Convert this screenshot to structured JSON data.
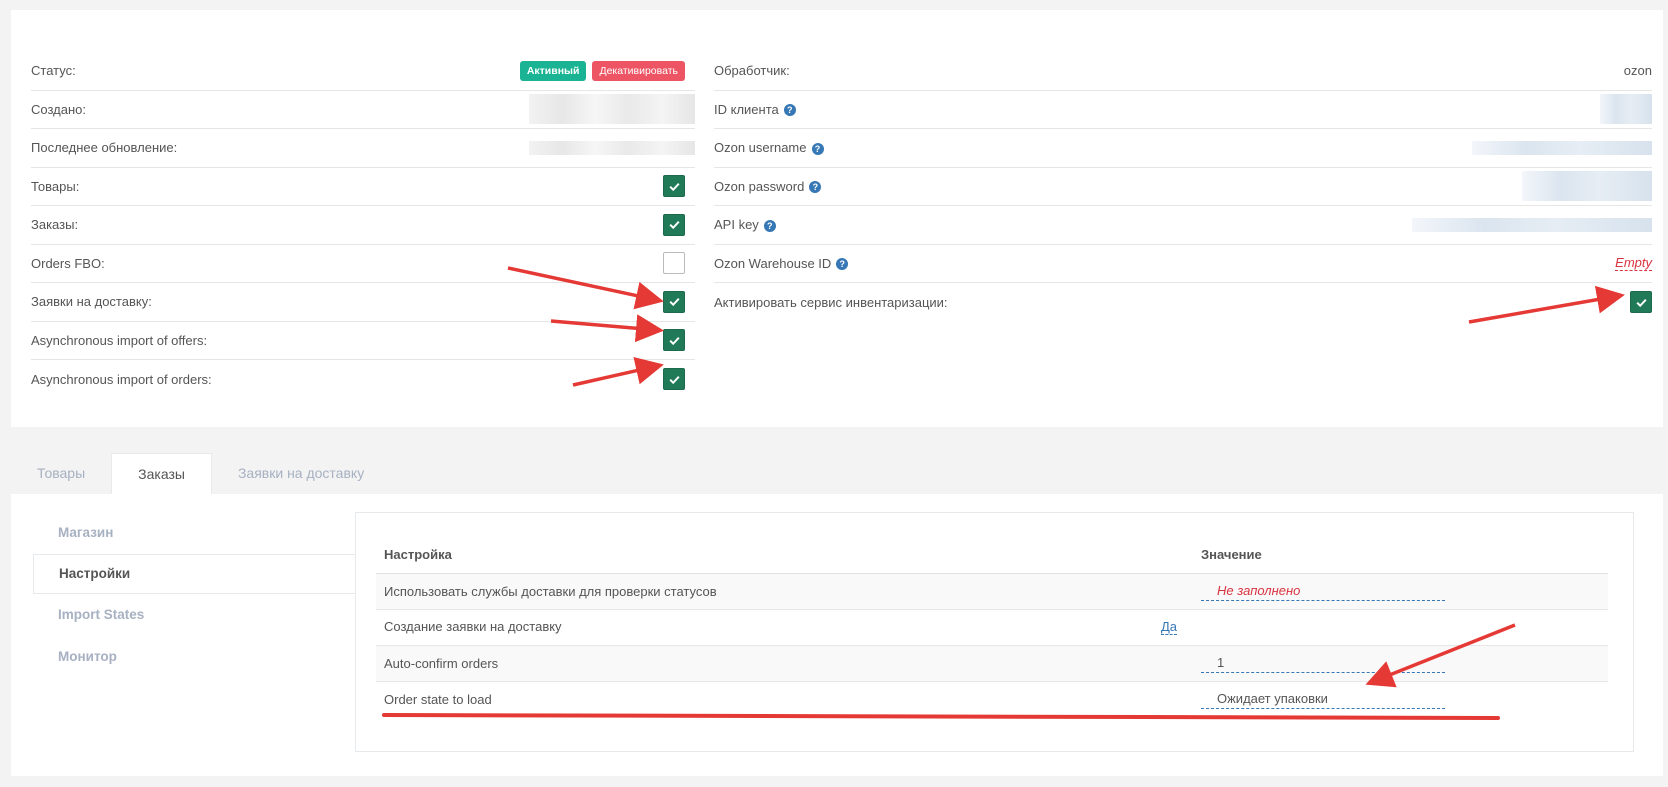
{
  "status_panel": {
    "left": [
      {
        "label": "Статус:",
        "type": "status"
      },
      {
        "label": "Создано:",
        "type": "blurred"
      },
      {
        "label": "Последнее обновление:",
        "type": "blurred-short"
      },
      {
        "label": "Товары:",
        "type": "checkbox",
        "checked": true
      },
      {
        "label": "Заказы:",
        "type": "checkbox",
        "checked": true
      },
      {
        "label": "Orders FBO:",
        "type": "checkbox",
        "checked": false
      },
      {
        "label": "Заявки на доставку:",
        "type": "checkbox",
        "checked": true
      },
      {
        "label": "Asynchronous import of offers:",
        "type": "checkbox",
        "checked": true
      },
      {
        "label": "Asynchronous import of orders:",
        "type": "checkbox",
        "checked": true
      }
    ],
    "status_badge": "Активный",
    "deactivate_button": "Декативировать",
    "right": [
      {
        "label": "Обработчик:",
        "value": "ozon"
      },
      {
        "label": "ID клиента",
        "help": true
      },
      {
        "label": "Ozon username",
        "help": true
      },
      {
        "label": "Ozon password",
        "help": true
      },
      {
        "label": "API key",
        "help": true
      },
      {
        "label": "Ozon Warehouse ID",
        "help": true,
        "value": "Empty"
      },
      {
        "label": "Активировать сервис инвентаризации:",
        "checkbox": true,
        "checked": true
      }
    ]
  },
  "tabs": [
    "Товары",
    "Заказы",
    "Заявки на доставку"
  ],
  "active_tab": 1,
  "side_nav": [
    "Магазин",
    "Настройки",
    "Import States",
    "Монитор"
  ],
  "active_side": 1,
  "settings_table": {
    "headers": [
      "Настройка",
      "Значение"
    ],
    "rows": [
      {
        "name": "Использовать службы доставки для проверки статусов",
        "value": "Не заполнено",
        "style": "red"
      },
      {
        "name": "Создание заявки на доставку",
        "value": "Да",
        "style": "link"
      },
      {
        "name": "Auto-confirm orders",
        "value": "1",
        "style": "normal"
      },
      {
        "name": "Order state to load",
        "value": "Ожидает упаковки",
        "style": "normal"
      }
    ]
  },
  "colors": {
    "checkbox_on": "#217a57",
    "badge_active": "#1ab394",
    "badge_deactivate": "#ed5565",
    "link": "#3677b5",
    "annotation_red": "#e53935"
  }
}
